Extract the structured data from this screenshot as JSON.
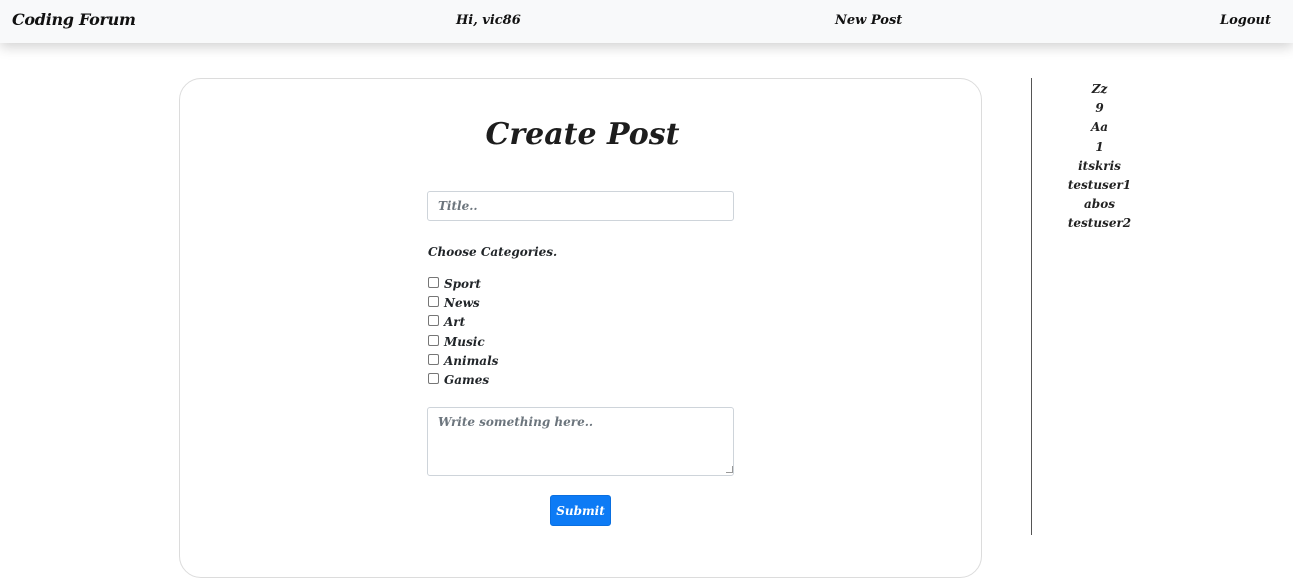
{
  "navbar": {
    "brand": "Coding Forum",
    "greeting": "Hi, vic86",
    "new_post": "New Post",
    "logout": "Logout"
  },
  "form": {
    "title": "Create Post",
    "title_placeholder": "Title..",
    "categories_heading": "Choose Categories.",
    "categories": [
      "Sport",
      "News",
      "Art",
      "Music",
      "Animals",
      "Games"
    ],
    "content_placeholder": "Write something here..",
    "submit_label": "Submit"
  },
  "users": [
    "Zz",
    "9",
    "Aa",
    "1",
    "itskris",
    "testuser1",
    "abos",
    "testuser2"
  ],
  "colors": {
    "navbar_bg": "#f8f9fa",
    "primary": "#0d7bf5"
  }
}
